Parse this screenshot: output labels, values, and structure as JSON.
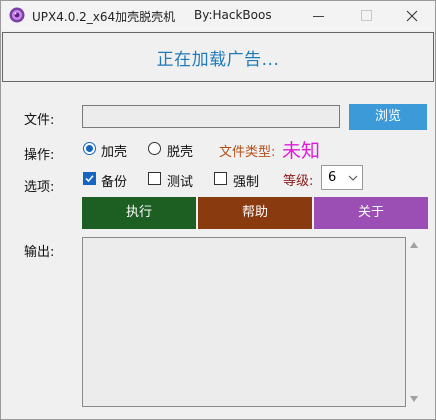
{
  "window": {
    "title": "UPX4.0.2_x64加壳脱壳机",
    "author": "By:HackBoos",
    "icon": "app-logo-icon",
    "controls": {
      "minimize": "minimize-icon",
      "maximize": "maximize-icon",
      "close": "close-icon"
    }
  },
  "banner": {
    "text": "正在加载广告..."
  },
  "file": {
    "label": "文件:",
    "value": "",
    "placeholder": "",
    "browse_label": "浏览"
  },
  "operation": {
    "label": "操作:",
    "options": [
      {
        "label": "加壳",
        "selected": true
      },
      {
        "label": "脱壳",
        "selected": false
      }
    ],
    "filetype_label": "文件类型:",
    "filetype_value": "未知"
  },
  "options": {
    "label": "选项:",
    "checks": [
      {
        "label": "备份",
        "checked": true
      },
      {
        "label": "测试",
        "checked": false
      },
      {
        "label": "强制",
        "checked": false
      }
    ],
    "level_label": "等级:",
    "level_value": "6"
  },
  "actions": {
    "run": "执行",
    "help": "帮助",
    "about": "关于"
  },
  "output": {
    "label": "输出:",
    "text": ""
  },
  "colors": {
    "accent": "#3c9ad8",
    "banner_text": "#1f7ab8",
    "run_button": "#1d5e22",
    "help_button": "#8a3a0f",
    "about_button": "#9b4fb5",
    "filetype_label": "#b3501a",
    "filetype_value": "#e01ad8",
    "level_label": "#8b1a1a"
  }
}
